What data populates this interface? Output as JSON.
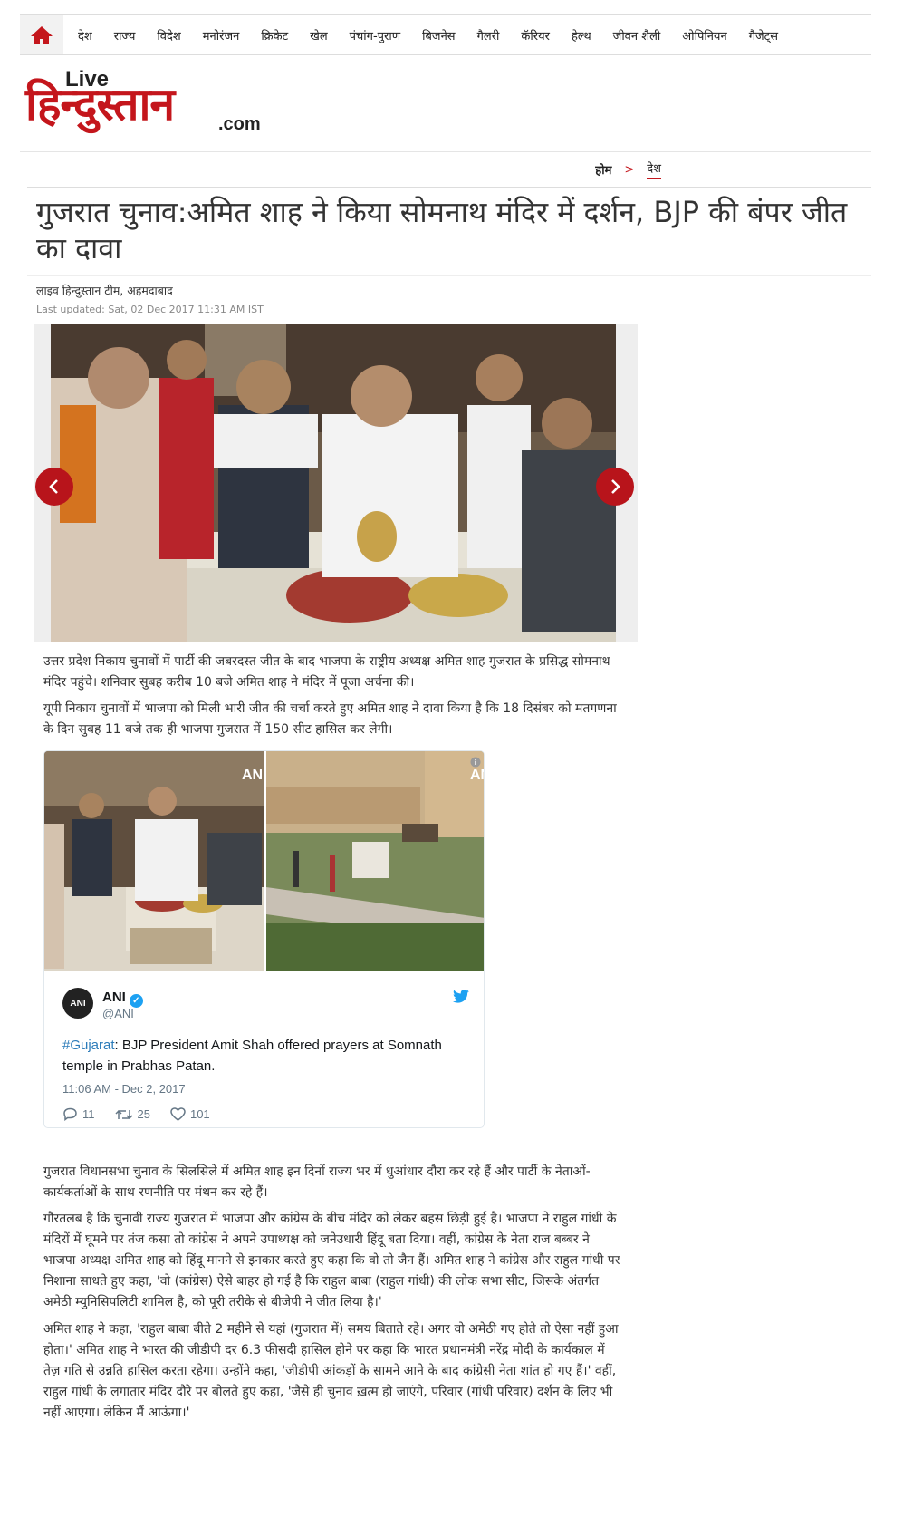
{
  "nav": {
    "items": [
      "देश",
      "राज्य",
      "विदेश",
      "मनोरंजन",
      "क्रिकेट",
      "खेल",
      "पंचांग-पुराण",
      "बिजनेस",
      "गैलरी",
      "कॅरियर",
      "हेल्थ",
      "जीवन शैली",
      "ओपिनियन",
      "गैजेट्स"
    ]
  },
  "logo": {
    "live": "Live",
    "main": "हिन्दुस्तान",
    "com": ".com"
  },
  "breadcrumb": {
    "home": "होम",
    "separator": ">",
    "current": "देश"
  },
  "article": {
    "headline": "गुजरात चुनाव:अमित शाह ने किया सोमनाथ मंदिर में दर्शन, BJP की बंपर जीत का दावा",
    "byline": "लाइव हिन्दुस्तान टीम, अहमदाबाद",
    "updated": "Last updated: Sat, 02 Dec 2017 11:31 AM IST",
    "para1": "उत्तर प्रदेश निकाय चुनावों में पार्टी की जबरदस्त जीत के बाद भाजपा के राष्ट्रीय अध्यक्ष अमित शाह गुजरात के प्रसिद्ध सोमनाथ मंदिर पहुंचे। शनिवार सुबह करीब 10 बजे अमित शाह ने मंदिर में पूजा अर्चना की।",
    "para2": "यूपी निकाय चुनावों में भाजपा को मिली भारी जीत की चर्चा करते हुए अमित शाह ने दावा किया है कि 18 दिसंबर को मतगणना के दिन सुबह 11 बजे तक ही भाजपा गुजरात में 150 सीट हासिल कर लेगी।",
    "para3": "गुजरात विधानसभा चुनाव के सिलसिले में अमित शाह इन दिनों राज्य भर में धुआंधार दौरा कर रहे हैं और पार्टी के नेताओं-कार्यकर्ताओं के साथ रणनीति पर मंथन कर रहे हैं।",
    "para4": "गौरतलब है कि चुनावी राज्य गुजरात में भाजपा और कांग्रेस के बीच मंदिर को लेकर बहस छिड़ी हुई है। भाजपा ने राहुल गांधी के मंदिरों में घूमने पर तंज कसा तो कांग्रेस ने अपने उपाध्यक्ष को जनेउधारी हिंदू बता दिया। वहीं, कांग्रेस के नेता राज बब्बर ने भाजपा अध्यक्ष अमित शाह को हिंदू मानने से इनकार करते हुए कहा कि वो तो जैन हैं। अमित शाह ने कांग्रेस और राहुल गांधी पर निशाना साधते हुए कहा, 'वो (कांग्रेस) ऐसे बाहर हो गई है कि राहुल बाबा (राहुल गांधी) की लोक सभा सीट, जिसके अंतर्गत अमेठी म्युनिसिपलिटी शामिल है, को पूरी तरीके से बीजेपी ने जीत लिया है।'",
    "para5": "अमित शाह ने कहा, 'राहुल बाबा बीते 2 महीने से यहां (गुजरात में) समय बिताते रहे। अगर वो अमेठी गए होते तो ऐसा नहीं हुआ होता।' अमित शाह ने भारत की जीडीपी दर 6.3 फीसदी हासिल होने पर कहा कि भारत प्रधानमंत्री नरेंद्र मोदी के कार्यकाल में तेज़ गति से उन्नति हासिल करता रहेगा। उन्होंने कहा, 'जीडीपी आंकड़ों के सामने आने के बाद कांग्रेसी नेता शांत हो गए हैं।' वहीं, राहुल गांधी के लगातार मंदिर दौरे पर बोलते हुए कहा, 'जैसे ही चुनाव ख़त्म हो जाएंगे, परिवार (गांधी परिवार) दर्शन के लिए भी नहीं आएगा। लेकिन मैं आऊंगा।'"
  },
  "tweet": {
    "avatar_text": "ANI",
    "name": "ANI",
    "handle": "@ANI",
    "hashtag": "#Gujarat",
    "text": ": BJP President Amit Shah offered prayers at Somnath temple in Prabhas Patan.",
    "time": "11:06 AM - Dec 2, 2017",
    "replies": "11",
    "retweets": "25",
    "likes": "101",
    "watermark": "AN"
  },
  "colors": {
    "brand": "#c4161c",
    "twitter": "#1da1f2",
    "link": "#2b7bb9"
  },
  "icons": [
    "home-icon",
    "chevron-left-icon",
    "chevron-right-icon",
    "verified-icon",
    "twitter-bird-icon",
    "reply-icon",
    "retweet-icon",
    "like-icon",
    "info-icon"
  ]
}
